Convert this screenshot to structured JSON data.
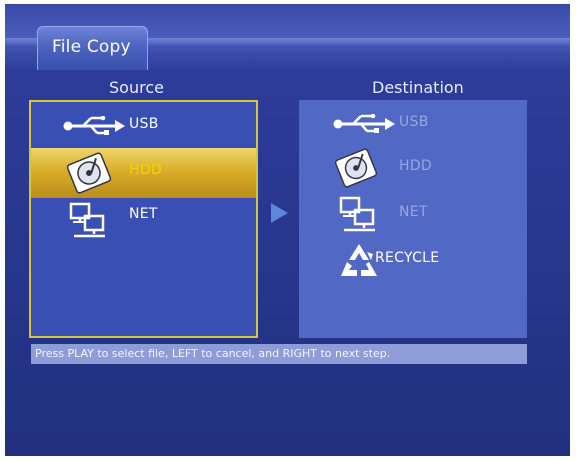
{
  "header": {
    "title": "File Copy"
  },
  "source": {
    "heading": "Source",
    "items": [
      {
        "label": "USB",
        "icon": "usb-icon"
      },
      {
        "label": "HDD",
        "icon": "hdd-icon",
        "selected": true
      },
      {
        "label": "NET",
        "icon": "net-icon"
      }
    ]
  },
  "destination": {
    "heading": "Destination",
    "items": [
      {
        "label": "USB",
        "icon": "usb-icon"
      },
      {
        "label": "HDD",
        "icon": "hdd-icon"
      },
      {
        "label": "NET",
        "icon": "net-icon"
      },
      {
        "label": "RECYCLE",
        "icon": "recycle-icon"
      }
    ]
  },
  "help": {
    "text": "Press PLAY to select file, LEFT to cancel, and RIGHT to next step."
  },
  "colors": {
    "background": "#2a3892",
    "selection": "#d8ae2a",
    "selection_text": "#f2d400",
    "source_border": "#d6c43a",
    "dest_panel": "#5169c4"
  }
}
